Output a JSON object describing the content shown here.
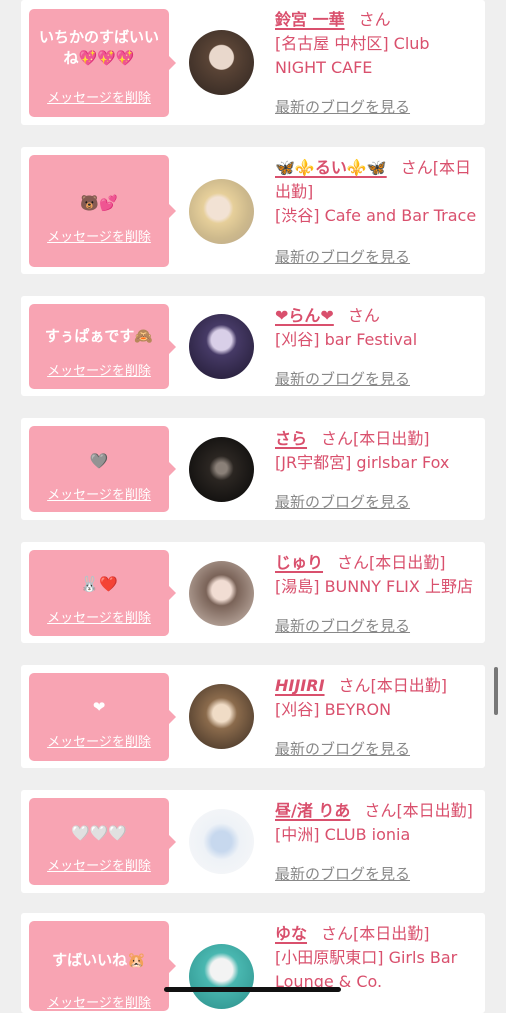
{
  "delete_label": "メッセージを削除",
  "blog_label": "最新のブログを見る",
  "san": "さん",
  "colors": {
    "accent": "#d9506d",
    "bubble": "#f8a4b3",
    "background": "#efefef"
  },
  "cards": [
    {
      "message": "いちかのすばいいね💖💖💖",
      "name": "鈴宮 一華",
      "status": "",
      "shop": "[名古屋 中村区] Club NIGHT CAFE"
    },
    {
      "message": "🐻💕",
      "name": "🦋⚜️るい⚜️🦋",
      "status": "[本日出勤]",
      "shop": "[渋谷] Cafe and Bar Trace"
    },
    {
      "message": "すぅぱぁです🙈",
      "name": "❤らん❤",
      "status": "",
      "shop": "[刈谷] bar Festival"
    },
    {
      "message": "🩶",
      "name": "さら",
      "status": "[本日出勤]",
      "shop": "[JR宇都宮] girlsbar Fox"
    },
    {
      "message": "🐰❤️",
      "name": "じゅり",
      "status": "[本日出勤]",
      "shop": "[湯島] BUNNY FLIX 上野店"
    },
    {
      "message": "❤",
      "name": "HIJIRI",
      "status": "[本日出勤]",
      "shop": "[刈谷] BEYRON"
    },
    {
      "message": "🤍🤍🤍",
      "name": "昼/渚 りあ",
      "status": "[本日出勤]",
      "shop": "[中洲] CLUB ionia"
    },
    {
      "message": "すばいいね🐹",
      "name": "ゆな",
      "status": "[本日出勤]",
      "shop": "[小田原駅東口] Girls Bar Lounge & Co."
    }
  ]
}
